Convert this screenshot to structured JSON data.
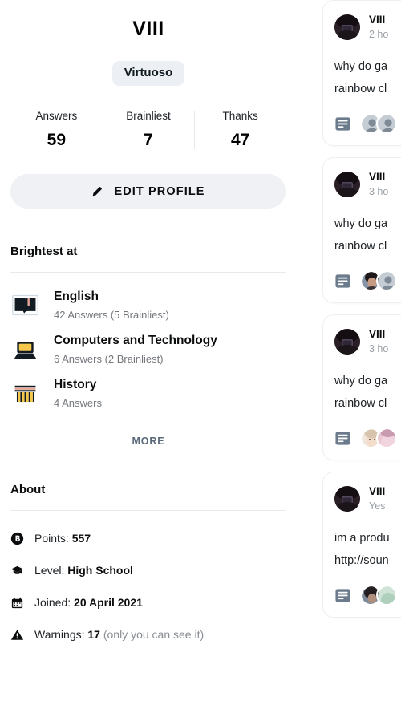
{
  "profile": {
    "username": "VIII",
    "rank": "Virtuoso",
    "stats": [
      {
        "label": "Answers",
        "value": "59"
      },
      {
        "label": "Brainliest",
        "value": "7"
      },
      {
        "label": "Thanks",
        "value": "47"
      }
    ],
    "edit_button": "EDIT PROFILE",
    "brightest_at": {
      "title": "Brightest at",
      "more_label": "MORE",
      "subjects": [
        {
          "icon": "book-icon",
          "name": "English",
          "meta": "42 Answers (5 Brainliest)"
        },
        {
          "icon": "laptop-icon",
          "name": "Computers and Technology",
          "meta": "6 Answers (2 Brainliest)"
        },
        {
          "icon": "pillar-icon",
          "name": "History",
          "meta": "4 Answers"
        }
      ]
    },
    "about": {
      "title": "About",
      "rows": [
        {
          "icon": "brainly-points-icon",
          "label": "Points: ",
          "value": "557",
          "note": ""
        },
        {
          "icon": "graduation-cap-icon",
          "label": "Level: ",
          "value": "High School",
          "note": ""
        },
        {
          "icon": "calendar-icon",
          "label": "Joined: ",
          "value": "20 April 2021",
          "note": ""
        },
        {
          "icon": "warning-icon",
          "label": "Warnings: ",
          "value": "17",
          "note": " (only you can see it)"
        }
      ]
    }
  },
  "feed": {
    "cards": [
      {
        "author": "VIII",
        "time": "2 ho",
        "line1": "why do ga",
        "line2": "rainbow cl",
        "answer_icon": "answer-lines-icon",
        "responders": [
          "placeholder-avatar",
          "placeholder-avatar"
        ]
      },
      {
        "author": "VIII",
        "time": "3 ho",
        "line1": "why do ga",
        "line2": "rainbow cl",
        "answer_icon": "answer-lines-icon",
        "responders": [
          "photo-avatar-dark",
          "placeholder-avatar"
        ]
      },
      {
        "author": "VIII",
        "time": "3 ho",
        "line1": "why do ga",
        "line2": "rainbow cl",
        "answer_icon": "answer-lines-icon",
        "responders": [
          "photo-avatar-light",
          "photo-avatar-pink"
        ]
      },
      {
        "author": "VIII",
        "time": "Yes",
        "line1": "im a produ",
        "line2": "http://soun",
        "answer_icon": "answer-lines-icon",
        "responders": [
          "photo-avatar-dark",
          "photo-avatar-green"
        ]
      }
    ]
  },
  "colors": {
    "badge_bg": "#eceff4",
    "button_bg": "#eff1f5",
    "muted_text": "#74787d",
    "more_text": "#5b6b7c",
    "card_border": "#edeff2",
    "icon_blue_gray": "#6b7b8c",
    "subject_yellow": "#f5c84c",
    "subject_dark": "#111b21",
    "subject_pink": "#e8a598"
  }
}
